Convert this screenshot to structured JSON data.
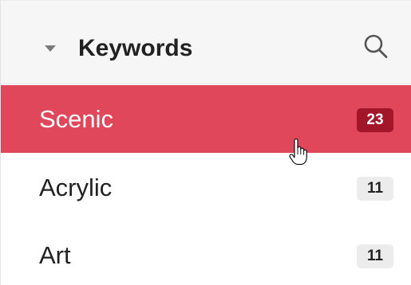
{
  "panel": {
    "title": "Keywords",
    "icons": {
      "collapse": "caret-down-icon",
      "search": "search-icon"
    }
  },
  "keywords": [
    {
      "label": "Scenic",
      "count": "23",
      "selected": true
    },
    {
      "label": "Acrylic",
      "count": "11",
      "selected": false
    },
    {
      "label": "Art",
      "count": "11",
      "selected": false
    }
  ],
  "colors": {
    "selected_row": "#e0475a",
    "selected_badge": "#a3162a",
    "badge": "#ececec",
    "header_bg": "#f6f6f6"
  }
}
